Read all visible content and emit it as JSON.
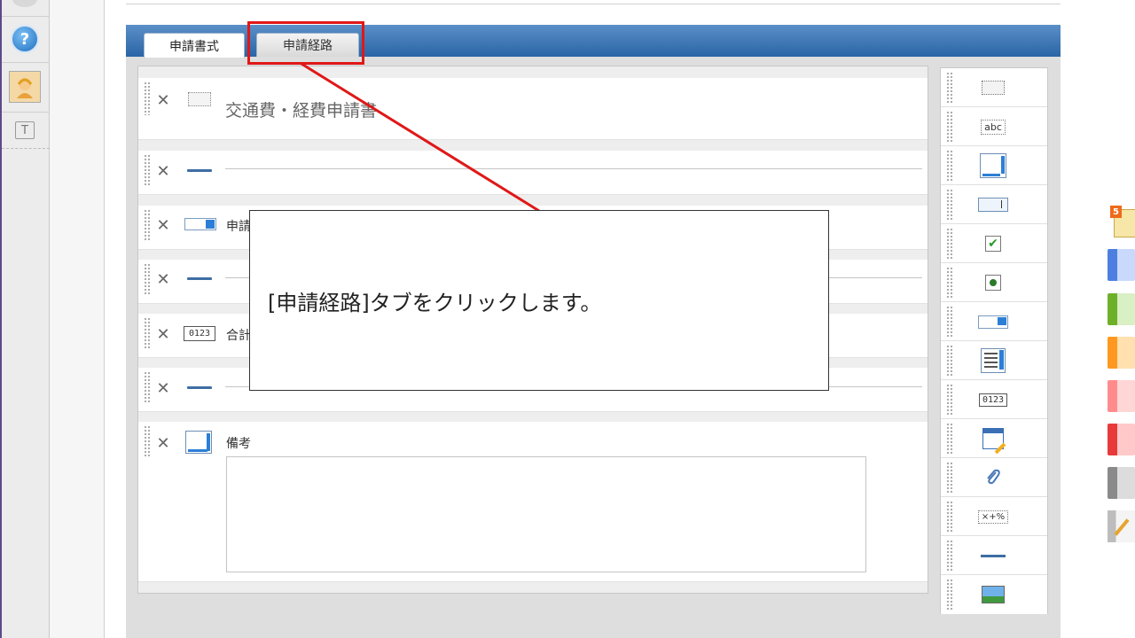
{
  "tabs": [
    {
      "label": "申請書式"
    },
    {
      "label": "申請経路"
    }
  ],
  "form": {
    "title": "交通費・経費申請書",
    "row_select_label": "申請",
    "row_number_label": "合計",
    "row_textarea_label": "備考",
    "delete_glyph": "✕"
  },
  "palette": {
    "text_icon": "abc",
    "number_icon": "0123",
    "calc_icon": "×+%"
  },
  "sidebar": {
    "help_glyph": "?",
    "text_glyph": "T"
  },
  "right_strip": {
    "badge": "5"
  },
  "callout": {
    "text": "[申請経路]タブをクリックします。"
  },
  "colors": {
    "tab_bar": "#3a74b3",
    "highlight": "#e01818",
    "swatches": [
      "#5b8ee8",
      "#7cc242",
      "#ffa42e",
      "#ff9a9a",
      "#f04a4a",
      "#9a9a9a"
    ]
  }
}
